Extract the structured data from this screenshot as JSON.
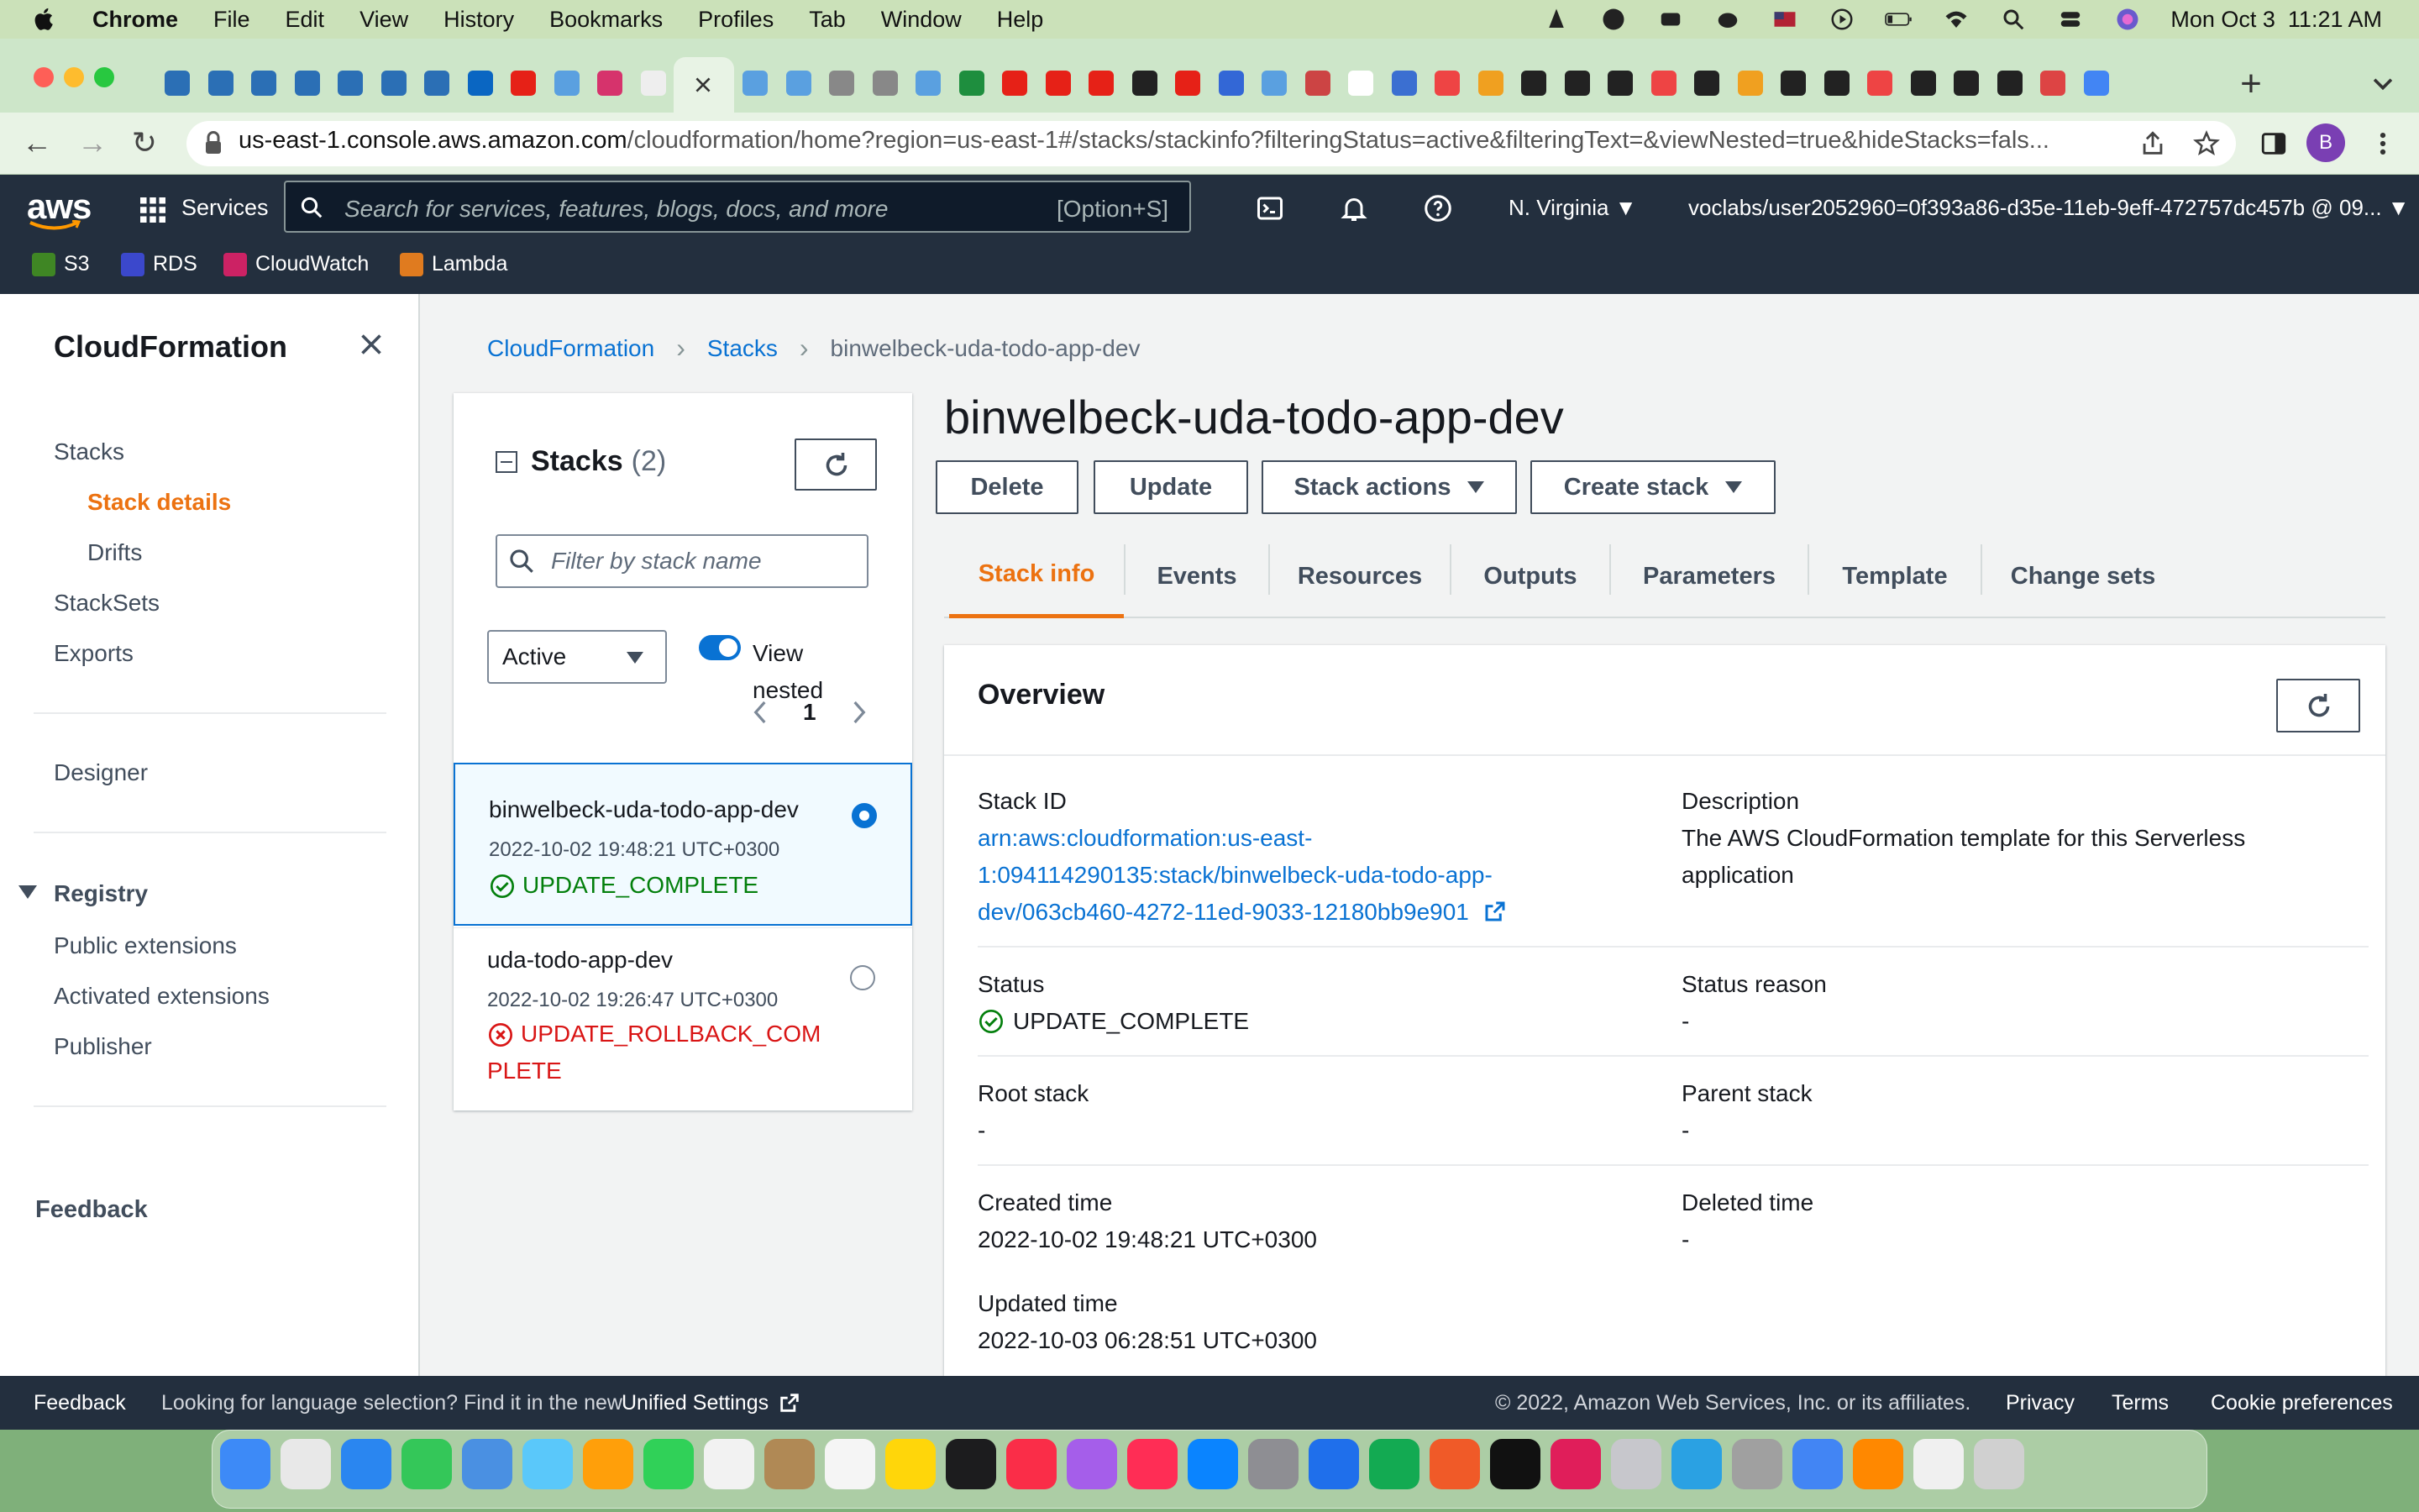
{
  "menubar": {
    "app": "Chrome",
    "items": [
      "File",
      "Edit",
      "View",
      "History",
      "Bookmarks",
      "Profiles",
      "Tab",
      "Window",
      "Help"
    ],
    "datetime": "Mon Oct 3  11:21 AM"
  },
  "browser": {
    "url_host": "us-east-1.console.aws.amazon.com",
    "url_path": "/cloudformation/home?region=us-east-1#/stacks/stackinfo?filteringStatus=active&filteringText=&viewNested=true&hideStacks=fals...",
    "profile_initial": "B"
  },
  "aws_header": {
    "logo": "aws",
    "services_label": "Services",
    "search_placeholder": "Search for services, features, blogs, docs, and more",
    "search_shortcut": "[Option+S]",
    "region": "N. Virginia",
    "account": "voclabs/user2052960=0f393a86-d35e-11eb-9eff-472757dc457b @ 09...",
    "favorites": [
      "S3",
      "RDS",
      "CloudWatch",
      "Lambda"
    ]
  },
  "sidenav": {
    "title": "CloudFormation",
    "stacks": "Stacks",
    "stack_details": "Stack details",
    "drifts": "Drifts",
    "stacksets": "StackSets",
    "exports": "Exports",
    "designer": "Designer",
    "registry": "Registry",
    "public_extensions": "Public extensions",
    "activated_extensions": "Activated extensions",
    "publisher": "Publisher",
    "feedback": "Feedback"
  },
  "breadcrumb": {
    "root": "CloudFormation",
    "stacks": "Stacks",
    "current": "binwelbeck-uda-todo-app-dev"
  },
  "stacks_panel": {
    "title": "Stacks",
    "count": "(2)",
    "filter_placeholder": "Filter by stack name",
    "status_filter": "Active",
    "view_nested_label": "View nested",
    "page": "1",
    "stacks": [
      {
        "name": "binwelbeck-uda-todo-app-dev",
        "time": "2022-10-02 19:48:21 UTC+0300",
        "status": "UPDATE_COMPLETE"
      },
      {
        "name": "uda-todo-app-dev",
        "time": "2022-10-02 19:26:47 UTC+0300",
        "status_line1": "UPDATE_ROLLBACK_COM",
        "status_line2": "PLETE"
      }
    ]
  },
  "detail": {
    "title": "binwelbeck-uda-todo-app-dev",
    "buttons": {
      "delete": "Delete",
      "update": "Update",
      "stack_actions": "Stack actions",
      "create_stack": "Create stack"
    },
    "tabs": [
      "Stack info",
      "Events",
      "Resources",
      "Outputs",
      "Parameters",
      "Template",
      "Change sets"
    ]
  },
  "overview": {
    "title": "Overview",
    "stack_id_label": "Stack ID",
    "stack_id_lines": [
      "arn:aws:cloudformation:us-east-",
      "1:094114290135:stack/binwelbeck-uda-todo-app-",
      "dev/063cb460-4272-11ed-9033-12180bb9e901"
    ],
    "description_label": "Description",
    "description_lines": [
      "The AWS CloudFormation template for this Serverless",
      "application"
    ],
    "status_label": "Status",
    "status_value": "UPDATE_COMPLETE",
    "status_reason_label": "Status reason",
    "status_reason_value": "-",
    "root_stack_label": "Root stack",
    "root_stack_value": "-",
    "parent_stack_label": "Parent stack",
    "parent_stack_value": "-",
    "created_label": "Created time",
    "created_value": "2022-10-02 19:48:21 UTC+0300",
    "deleted_label": "Deleted time",
    "deleted_value": "-",
    "updated_label": "Updated time",
    "updated_value": "2022-10-03 06:28:51 UTC+0300"
  },
  "footer": {
    "feedback": "Feedback",
    "language_text": "Looking for language selection? Find it in the new",
    "unified_settings": "Unified Settings",
    "copyright": "© 2022, Amazon Web Services, Inc. or its affiliates.",
    "privacy": "Privacy",
    "terms": "Terms",
    "cookies": "Cookie preferences"
  },
  "colors": {
    "aws_nav": "#232f3e",
    "link": "#0972d3",
    "active_orange": "#ec7211",
    "success": "#037f0c",
    "error": "#d91515"
  }
}
